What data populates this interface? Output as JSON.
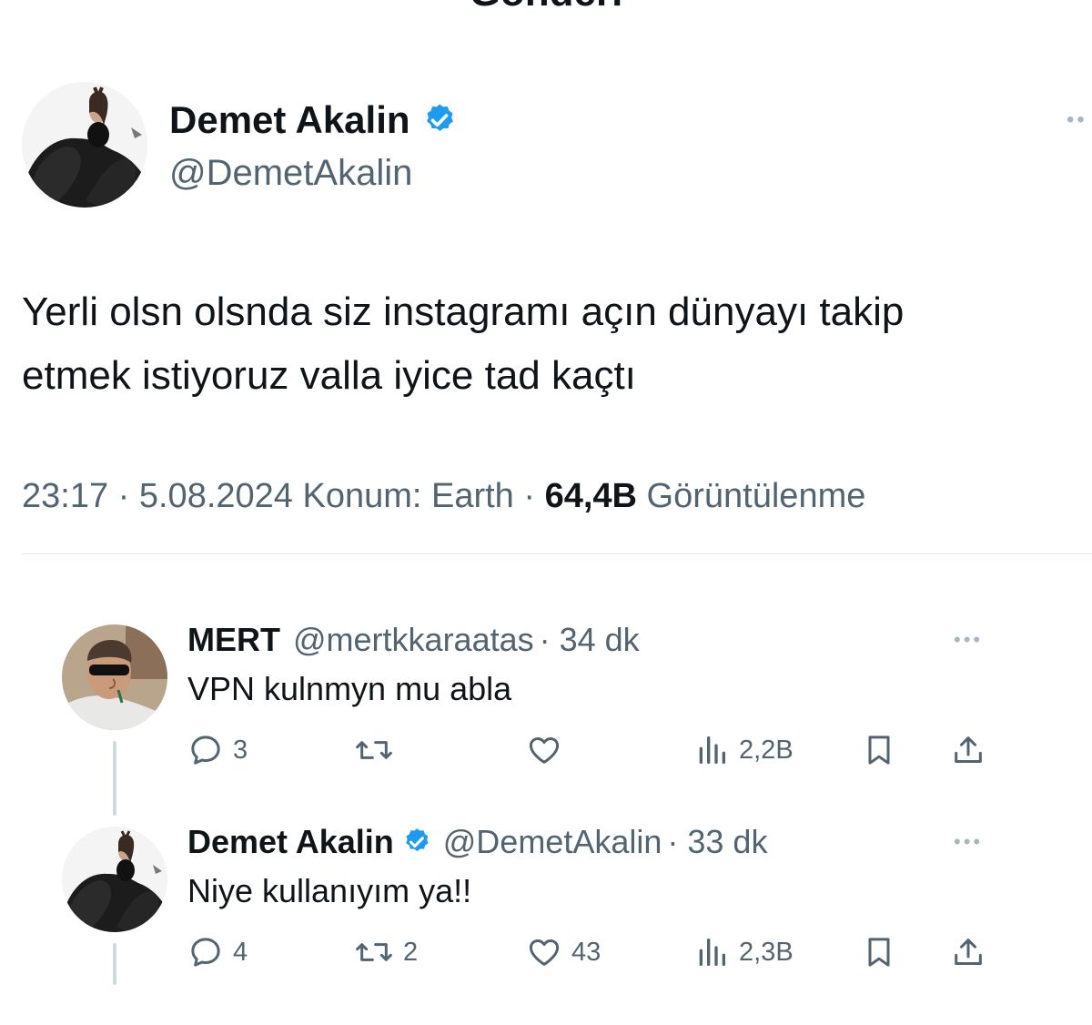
{
  "header": {
    "title": "Gönderi"
  },
  "tweet": {
    "author_name": "Demet Akalin",
    "author_handle": "@DemetAkalin",
    "text_line1": "Yerli olsn olsnda siz instagramı açın dünyayı takip",
    "text_line2": "etmek istiyoruz valla iyice tad kaçtı",
    "time_date": "23:17 · 5.08.2024 Konum: Earth · ",
    "views_count": "64,4B",
    "views_label": " Görüntülenme",
    "more_icon": "more-dots-icon"
  },
  "replies": [
    {
      "name": "MERT",
      "handle": "@mertkkaraatas",
      "age": "· 34 dk",
      "text": "VPN kulnmyn mu abla",
      "verified": false,
      "replies_count": "3",
      "reposts_count": "",
      "likes_count": "",
      "views_count": "2,2B"
    },
    {
      "name": "Demet Akalin",
      "handle": "@DemetAkalin",
      "age": "· 33 dk",
      "text": "Niye kullanıyım ya!!",
      "verified": true,
      "replies_count": "4",
      "reposts_count": "2",
      "likes_count": "43",
      "views_count": "2,3B"
    }
  ],
  "colors": {
    "verified_blue": "#1d9bf0",
    "text_primary": "#0f1419",
    "text_secondary": "#536471"
  }
}
